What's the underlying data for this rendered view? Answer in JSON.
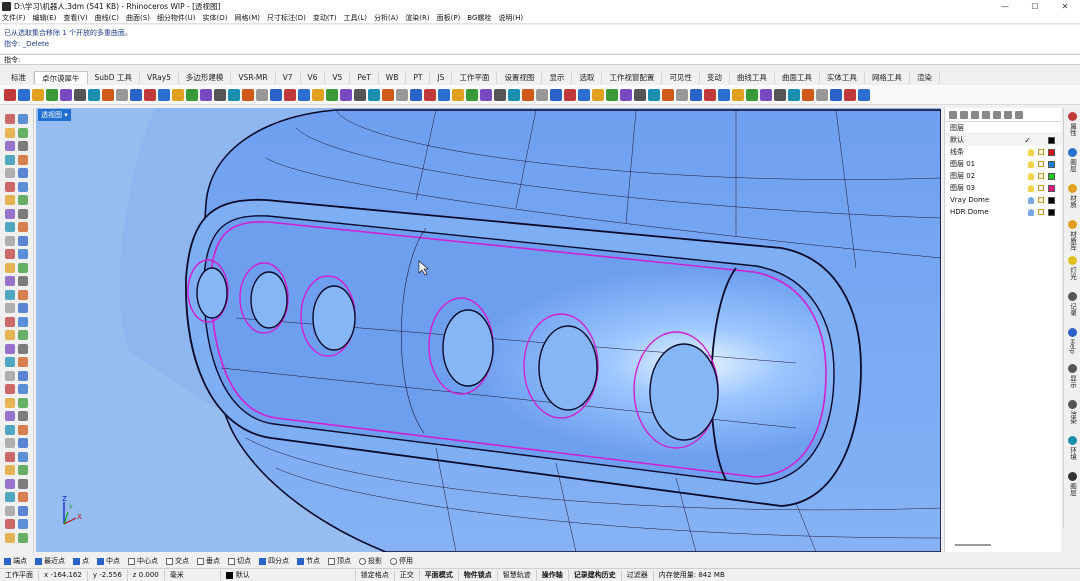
{
  "window": {
    "title": "D:\\学习\\机器人.3dm (541 KB) - Rhinoceros WIP - [透视图]",
    "controls": [
      "—",
      "☐",
      "✕"
    ]
  },
  "menu": [
    "文件(F)",
    "编辑(E)",
    "查看(V)",
    "曲线(C)",
    "曲面(S)",
    "细分物件(U)",
    "实体(O)",
    "网格(M)",
    "尺寸标注(D)",
    "变动(T)",
    "工具(L)",
    "分析(A)",
    "渲染(R)",
    "面板(P)",
    "BG螺栓",
    "说明(H)"
  ],
  "command": {
    "history": [
      "已从选取集合移除 1 个开放的多重曲面。",
      "指令: _Delete"
    ],
    "prompt": "指令:"
  },
  "tabs": [
    "标准",
    "卓尔谟犀牛",
    "SubD 工具",
    "VRay5",
    "多边形建模",
    "VSR-MR",
    "V7",
    "V6",
    "V5",
    "PeT",
    "WB",
    "PT",
    "JS",
    "工作平面",
    "设置视图",
    "显示",
    "选取",
    "工作视窗配置",
    "可见性",
    "变动",
    "曲线工具",
    "曲面工具",
    "实体工具",
    "网格工具",
    "渲染"
  ],
  "active_tab_index": 1,
  "viewport": {
    "label": "透视图",
    "axes": {
      "x": "X",
      "y": "Y",
      "z": "Z"
    }
  },
  "layers_panel": {
    "header": "图层",
    "layers": [
      {
        "name": "默认",
        "color": "#000000",
        "current": true
      },
      {
        "name": "线条",
        "color": "#e01010",
        "current": false
      },
      {
        "name": "图层 01",
        "color": "#1a7be0",
        "current": false
      },
      {
        "name": "图层 02",
        "color": "#1ec21e",
        "current": false
      },
      {
        "name": "图层 03",
        "color": "#e0147e",
        "current": false
      },
      {
        "name": "Vray Dome",
        "color": "#000000",
        "current": false
      },
      {
        "name": "HDR Dome",
        "color": "#000000",
        "current": false
      }
    ]
  },
  "side_tabs": [
    "属性",
    "图层",
    "材质",
    "材质库",
    "灯光",
    "记录",
    "Help",
    "显示",
    "渲染",
    "环境",
    "图层"
  ],
  "osnaps": [
    {
      "label": "端点",
      "on": true
    },
    {
      "label": "最近点",
      "on": true
    },
    {
      "label": "点",
      "on": true
    },
    {
      "label": "中点",
      "on": true
    },
    {
      "label": "中心点",
      "on": false
    },
    {
      "label": "交点",
      "on": false
    },
    {
      "label": "垂点",
      "on": false
    },
    {
      "label": "切点",
      "on": false
    },
    {
      "label": "四分点",
      "on": true
    },
    {
      "label": "节点",
      "on": true
    },
    {
      "label": "顶点",
      "on": false
    },
    {
      "label": "投影",
      "on": false
    },
    {
      "label": "停用",
      "on": false
    }
  ],
  "status": {
    "cplane": "工作平面",
    "x": "x -164.162",
    "y": "y -2.556",
    "z": "z 0.000",
    "units": "毫米",
    "layer": "默认",
    "toggles": [
      {
        "label": "锁定格点",
        "bold": false
      },
      {
        "label": "正交",
        "bold": false
      },
      {
        "label": "平面模式",
        "bold": true
      },
      {
        "label": "物件锁点",
        "bold": true
      },
      {
        "label": "智慧轨迹",
        "bold": false
      },
      {
        "label": "操作轴",
        "bold": true
      },
      {
        "label": "记录建构历史",
        "bold": true
      },
      {
        "label": "过滤器",
        "bold": false
      }
    ],
    "memory": "内存使用量: 842 MB"
  },
  "colors": {
    "viewport_bg": "#8fb6ef",
    "surface": "#79a9f2",
    "highlight": "#d21fd2"
  }
}
